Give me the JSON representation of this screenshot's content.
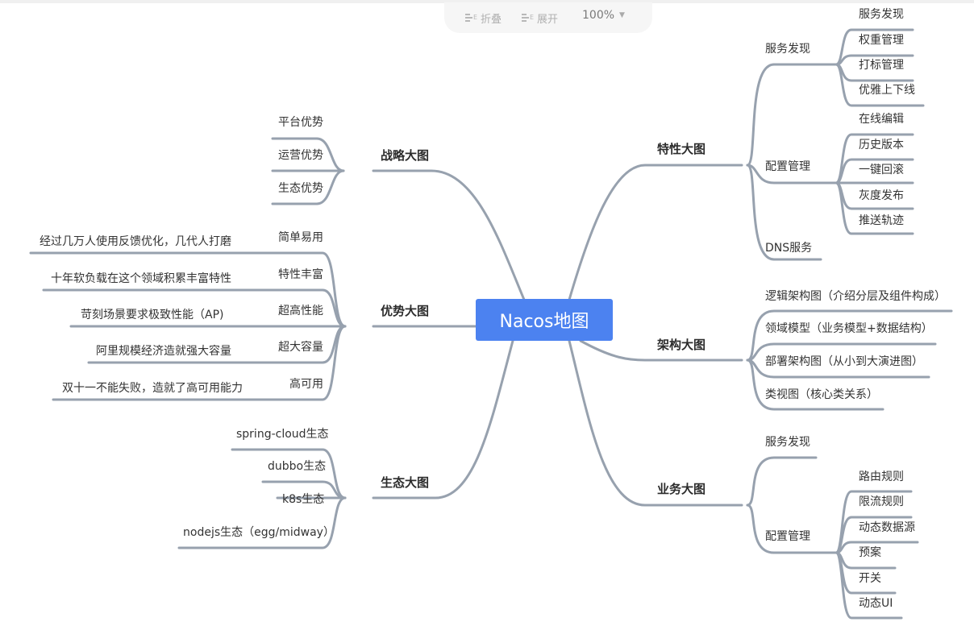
{
  "toolbar": {
    "collapse_label": "折叠",
    "expand_label": "展开",
    "zoom": "100%"
  },
  "root": "Nacos地图",
  "branches": {
    "strategy": {
      "label": "战略大图",
      "children": [
        "平台优势",
        "运营优势",
        "生态优势"
      ]
    },
    "advantage": {
      "label": "优势大图",
      "children": [
        {
          "label": "简单易用",
          "detail": "经过几万人使用反馈优化，几代人打磨"
        },
        {
          "label": "特性丰富",
          "detail": "十年软负载在这个领域积累丰富特性"
        },
        {
          "label": "超高性能",
          "detail": "苛刻场景要求极致性能（AP)"
        },
        {
          "label": "超大容量",
          "detail": "阿里规模经济造就强大容量"
        },
        {
          "label": "高可用",
          "detail": "双十一不能失败，造就了高可用能力"
        }
      ]
    },
    "ecosystem": {
      "label": "生态大图",
      "children": [
        "spring-cloud生态",
        "dubbo生态",
        "k8s生态",
        "nodejs生态（egg/midway）"
      ]
    },
    "features": {
      "label": "特性大图",
      "service_discovery": {
        "label": "服务发现",
        "children": [
          "服务发现",
          "权重管理",
          "打标管理",
          "优雅上下线"
        ]
      },
      "config_management": {
        "label": "配置管理",
        "children": [
          "在线编辑",
          "历史版本",
          "一键回滚",
          "灰度发布",
          "推送轨迹"
        ]
      },
      "dns": {
        "label": "DNS服务"
      }
    },
    "architecture": {
      "label": "架构大图",
      "children": [
        "逻辑架构图（介绍分层及组件构成）",
        "领域模型（业务模型+数据结构）",
        "部署架构图（从小到大演进图）",
        "类视图（核心类关系）"
      ]
    },
    "business": {
      "label": "业务大图",
      "service_discovery": {
        "label": "服务发现"
      },
      "config_management": {
        "label": "配置管理",
        "children": [
          "路由规则",
          "限流规则",
          "动态数据源",
          "预案",
          "开关",
          "动态UI"
        ]
      }
    }
  }
}
